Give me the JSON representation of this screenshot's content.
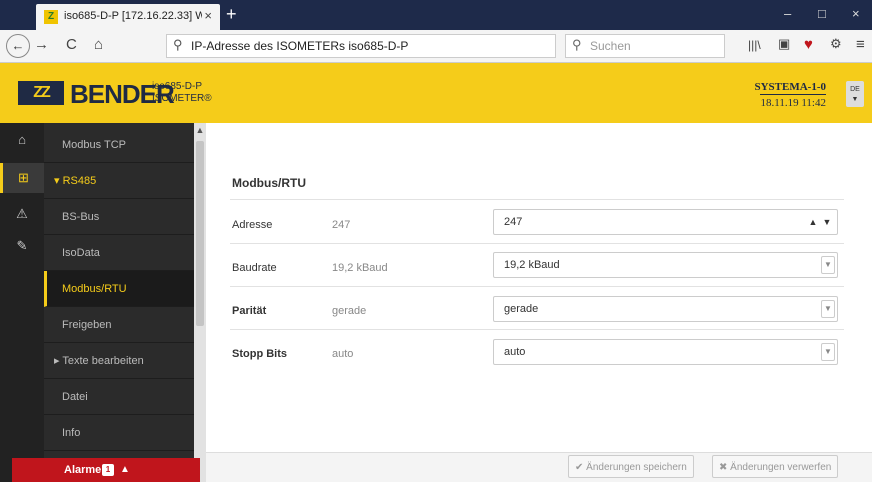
{
  "browser": {
    "tab_title": "iso685-D-P [172.16.22.33] Web",
    "tab_close": "×",
    "new_tab": "+",
    "window_controls": [
      "–",
      "□",
      "×"
    ],
    "url_text": "IP-Adresse des ISOMETERs iso685-D-P",
    "search_placeholder": "Suchen",
    "nav_icons": [
      "←",
      "→",
      "C",
      "⌂"
    ],
    "toolbar_icons": [
      "library-icon",
      "reader-icon",
      "pocket-icon",
      "extension-icon",
      "menu-icon"
    ]
  },
  "header": {
    "brand": "BENDER",
    "brand_mark": "ZZ",
    "device_name": "iso685-D-P",
    "device_type": "ISOMETER®",
    "system_name": "SYSTEMA-1-0",
    "datetime": "18.11.19 11:42",
    "language": "DE"
  },
  "rail": {
    "icons": [
      "home-icon",
      "tree-icon",
      "warning-icon",
      "wrench-icon"
    ],
    "glyphs": [
      "⌂",
      "⊞",
      "⚠",
      "✎"
    ],
    "active_index": 1
  },
  "menu": {
    "items": [
      {
        "label": "Modbus TCP",
        "kind": "child"
      },
      {
        "label": "▾ RS485",
        "kind": "parent"
      },
      {
        "label": "BS-Bus",
        "kind": "child"
      },
      {
        "label": "IsoData",
        "kind": "child"
      },
      {
        "label": "Modbus/RTU",
        "kind": "active"
      },
      {
        "label": "Freigeben",
        "kind": "child"
      },
      {
        "label": "▸ Texte bearbeiten",
        "kind": "collapsed"
      },
      {
        "label": "Datei",
        "kind": "child"
      },
      {
        "label": "Info",
        "kind": "child"
      }
    ]
  },
  "alarm": {
    "label": "Alarme",
    "count": "1",
    "arrow": "▲"
  },
  "main": {
    "section_title": "Modbus/RTU",
    "rows": [
      {
        "label": "Adresse",
        "current": "247",
        "value": "247",
        "control": "spinner"
      },
      {
        "label": "Baudrate",
        "current": "19,2 kBaud",
        "value": "19,2 kBaud",
        "control": "select"
      },
      {
        "label": "Parität",
        "current": "gerade",
        "value": "gerade",
        "control": "select"
      },
      {
        "label": "Stopp Bits",
        "current": "auto",
        "value": "auto",
        "control": "select"
      }
    ]
  },
  "footer": {
    "save_label": "✔ Änderungen speichern",
    "discard_label": "✖ Änderungen verwerfen"
  },
  "colors": {
    "brand_yellow": "#f5cc1a",
    "brand_navy": "#1f2a44",
    "sidebar_bg": "#2b2b2b",
    "alarm_red": "#c0151c"
  }
}
